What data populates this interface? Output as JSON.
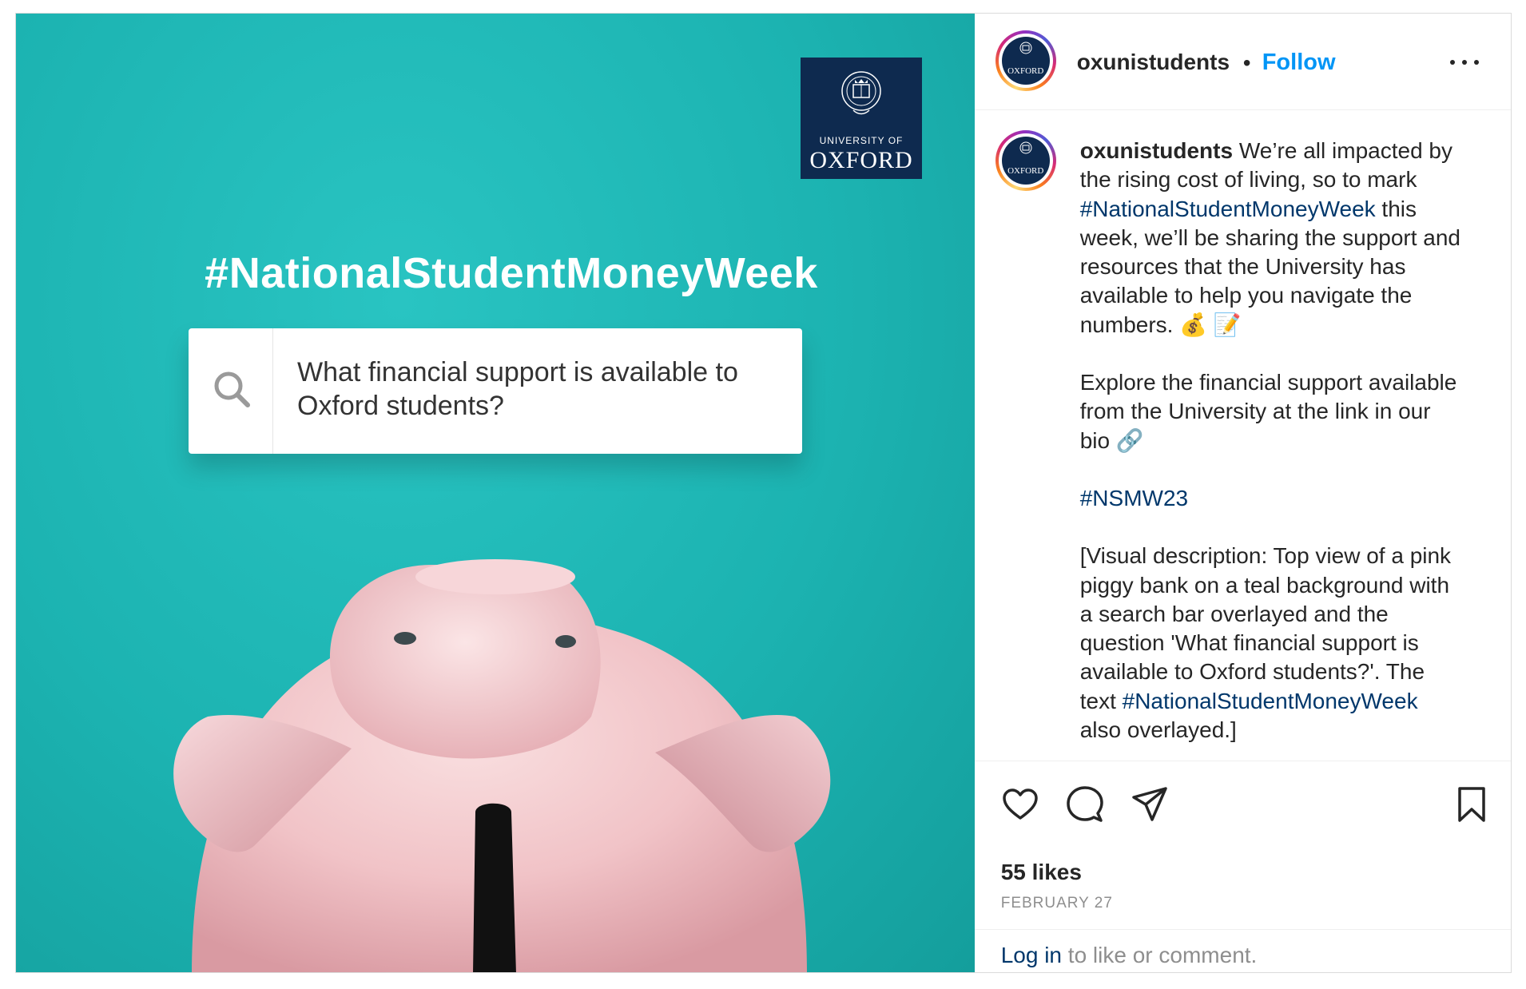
{
  "media": {
    "logo_small": "UNIVERSITY OF",
    "logo_big": "OXFORD",
    "hashtag": "#NationalStudentMoneyWeek",
    "search_question": "What financial support is available to Oxford students?",
    "search_icon": "search-icon"
  },
  "header": {
    "username": "oxunistudents",
    "separator": "•",
    "follow_label": "Follow",
    "more_icon": "more-options-icon"
  },
  "avatar": {
    "mini_text": "OXFORD"
  },
  "caption": {
    "username": "oxunistudents",
    "p1_a": "We’re all impacted by the rising cost of living, so to mark ",
    "p1_tag": "#NationalStudentMoneyWeek",
    "p1_b": " this week, we’ll be sharing the support and resources that the University has available to help you navigate the numbers. 💰 📝",
    "p2": "Explore the financial support available from the University at the link in our bio 🔗",
    "p3_tag": "#NSMW23",
    "p4_a": "[Visual description: Top view of a pink piggy bank on a teal background with a search bar overlayed and the question 'What financial support is available to Oxford students?'. The text ",
    "p4_tag": "#NationalStudentMoneyWeek",
    "p4_b": " also overlayed.]"
  },
  "actions": {
    "icons": [
      "heart-icon",
      "comment-icon",
      "share-icon",
      "bookmark-icon"
    ],
    "likes": "55 likes",
    "date": "FEBRUARY 27"
  },
  "footer": {
    "login_link": "Log in",
    "login_rest": " to like or comment."
  },
  "colors": {
    "teal": "#1cb3b1",
    "oxford_blue": "#0e2a4f",
    "link_blue": "#0095f6",
    "hashtag_blue": "#00376b",
    "pig_pink": "#f0c2c6"
  }
}
